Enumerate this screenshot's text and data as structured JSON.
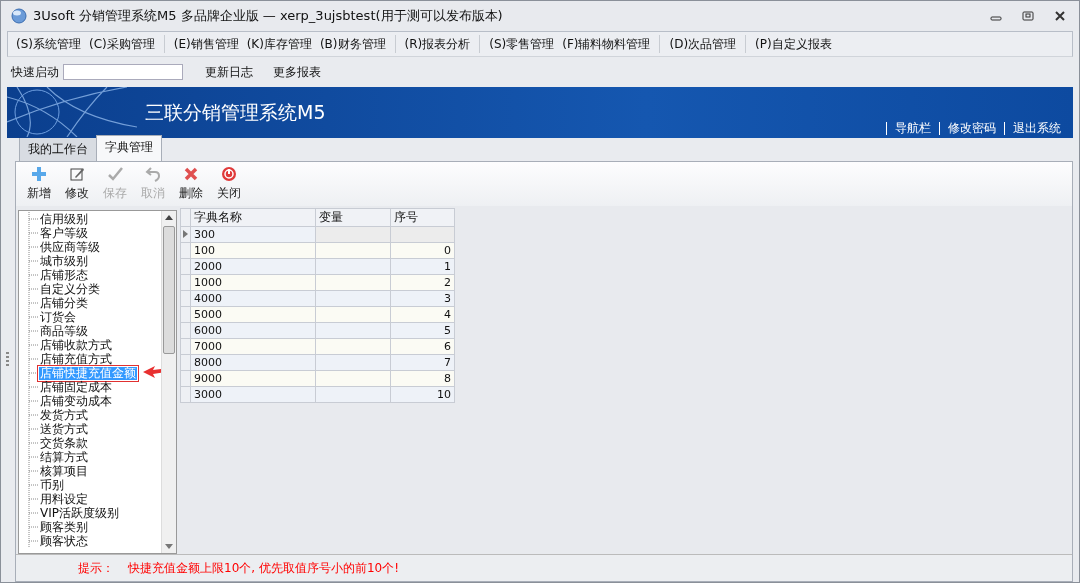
{
  "window": {
    "title": "3Usoft 分销管理系统M5 多品牌企业版 — xerp_3ujsbtest(用于测可以发布版本)"
  },
  "menu": [
    "(S)系统管理",
    "(C)采购管理",
    "(E)销售管理",
    "(K)库存管理",
    "(B)财务管理",
    "(R)报表分析",
    "(S)零售管理",
    "(F)辅料物料管理",
    "(D)次品管理",
    "(P)自定义报表"
  ],
  "quick_bar": {
    "label": "快速启动",
    "links": [
      "更新日志",
      "更多报表"
    ]
  },
  "banner": {
    "title": "三联分销管理系统M5",
    "links": [
      "导航栏",
      "修改密码",
      "退出系统"
    ]
  },
  "tabs": [
    {
      "label": "我的工作台",
      "selected": false
    },
    {
      "label": "字典管理",
      "selected": true
    }
  ],
  "toolbar": [
    {
      "kind": "add",
      "label": "新增",
      "disabled": false
    },
    {
      "kind": "edit",
      "label": "修改",
      "disabled": false
    },
    {
      "kind": "save",
      "label": "保存",
      "disabled": true
    },
    {
      "kind": "undo",
      "label": "取消",
      "disabled": true
    },
    {
      "kind": "delete",
      "label": "删除",
      "disabled": false
    },
    {
      "kind": "close",
      "label": "关闭",
      "disabled": false
    }
  ],
  "tree": [
    {
      "label": "信用级别",
      "selected": false
    },
    {
      "label": "客户等级",
      "selected": false
    },
    {
      "label": "供应商等级",
      "selected": false
    },
    {
      "label": "城市级别",
      "selected": false
    },
    {
      "label": "店铺形态",
      "selected": false
    },
    {
      "label": "自定义分类",
      "selected": false
    },
    {
      "label": "店铺分类",
      "selected": false
    },
    {
      "label": "订货会",
      "selected": false
    },
    {
      "label": "商品等级",
      "selected": false
    },
    {
      "label": "店铺收款方式",
      "selected": false
    },
    {
      "label": "店铺充值方式",
      "selected": false
    },
    {
      "label": "店铺快捷充值金额",
      "selected": true
    },
    {
      "label": "店铺固定成本",
      "selected": false
    },
    {
      "label": "店铺变动成本",
      "selected": false
    },
    {
      "label": "发货方式",
      "selected": false
    },
    {
      "label": "送货方式",
      "selected": false
    },
    {
      "label": "交货条款",
      "selected": false
    },
    {
      "label": "结算方式",
      "selected": false
    },
    {
      "label": "核算项目",
      "selected": false
    },
    {
      "label": "币别",
      "selected": false
    },
    {
      "label": "用料设定",
      "selected": false
    },
    {
      "label": "VIP活跃度级别",
      "selected": false
    },
    {
      "label": "顾客类别",
      "selected": false
    },
    {
      "label": "顾客状态",
      "selected": false
    }
  ],
  "table": {
    "columns": [
      "字典名称",
      "变量",
      "序号"
    ],
    "rows": [
      {
        "cells": [
          "300",
          "",
          ""
        ],
        "selected": true
      },
      {
        "cells": [
          "100",
          "",
          "0"
        ],
        "selected": false
      },
      {
        "cells": [
          "2000",
          "",
          "1"
        ],
        "selected": false
      },
      {
        "cells": [
          "1000",
          "",
          "2"
        ],
        "selected": false
      },
      {
        "cells": [
          "4000",
          "",
          "3"
        ],
        "selected": false
      },
      {
        "cells": [
          "5000",
          "",
          "4"
        ],
        "selected": false
      },
      {
        "cells": [
          "6000",
          "",
          "5"
        ],
        "selected": false
      },
      {
        "cells": [
          "7000",
          "",
          "6"
        ],
        "selected": false
      },
      {
        "cells": [
          "8000",
          "",
          "7"
        ],
        "selected": false
      },
      {
        "cells": [
          "9000",
          "",
          "8"
        ],
        "selected": false
      },
      {
        "cells": [
          "3000",
          "",
          "10"
        ],
        "selected": false
      }
    ]
  },
  "hint": {
    "label": "提示：",
    "text": "快捷充值金额上限10个, 优先取值序号小的前10个!"
  }
}
